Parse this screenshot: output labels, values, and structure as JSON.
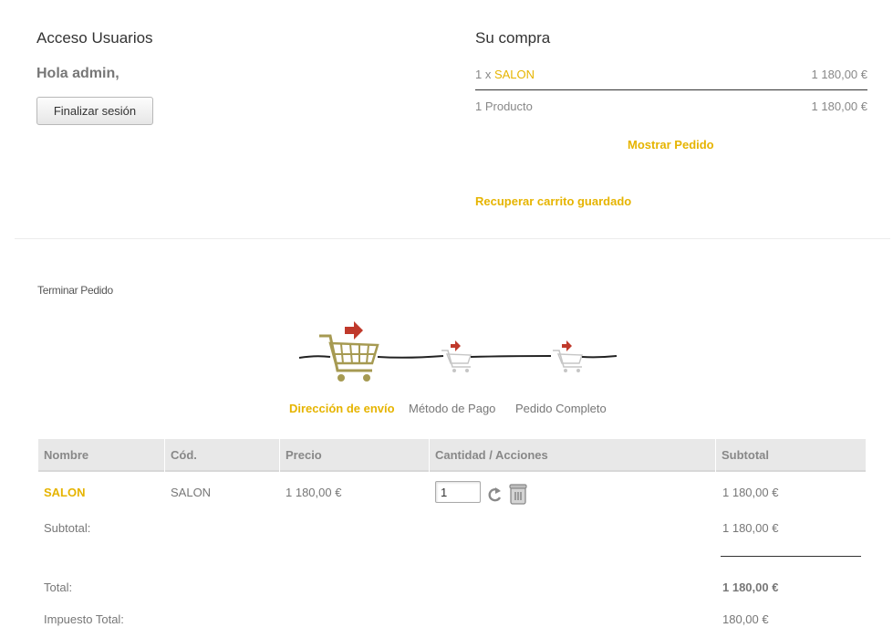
{
  "access": {
    "title": "Acceso Usuarios",
    "greeting": "Hola admin,",
    "logout_label": "Finalizar sesión"
  },
  "cart": {
    "title": "Su compra",
    "line_qty": "1 x ",
    "line_product": "SALON",
    "line_price": "1 180,00 €",
    "count_label": "1 Producto",
    "count_price": "1 180,00 €",
    "show_order": "Mostrar Pedido",
    "recover": "Recuperar carrito guardado"
  },
  "checkout": {
    "title": "Terminar Pedido",
    "steps": [
      "Dirección de envío",
      "Método de Pago",
      "Pedido Completo"
    ],
    "active_step": 0
  },
  "table": {
    "headers": [
      "Nombre",
      "Cód.",
      "Precio",
      "Cantidad / Acciones",
      "Subtotal"
    ],
    "rows": [
      {
        "name": "SALON",
        "code": "SALON",
        "price": "1 180,00 €",
        "quantity": "1",
        "subtotal": "1 180,00 €"
      }
    ],
    "subtotal_label": "Subtotal:",
    "subtotal_value": "1 180,00 €",
    "total_label": "Total:",
    "total_value": "1 180,00 €",
    "tax_label": "Impuesto Total:",
    "tax_value": "180,00 €"
  },
  "icons": {
    "cart": "cart-icon",
    "arrow": "arrow-icon",
    "refresh": "refresh-icon",
    "trash": "trash-icon"
  },
  "colors": {
    "accent": "#e6b400",
    "header_bg": "#e8e8e8",
    "cart_active": "#a69a52",
    "arrow": "#c0392b"
  }
}
